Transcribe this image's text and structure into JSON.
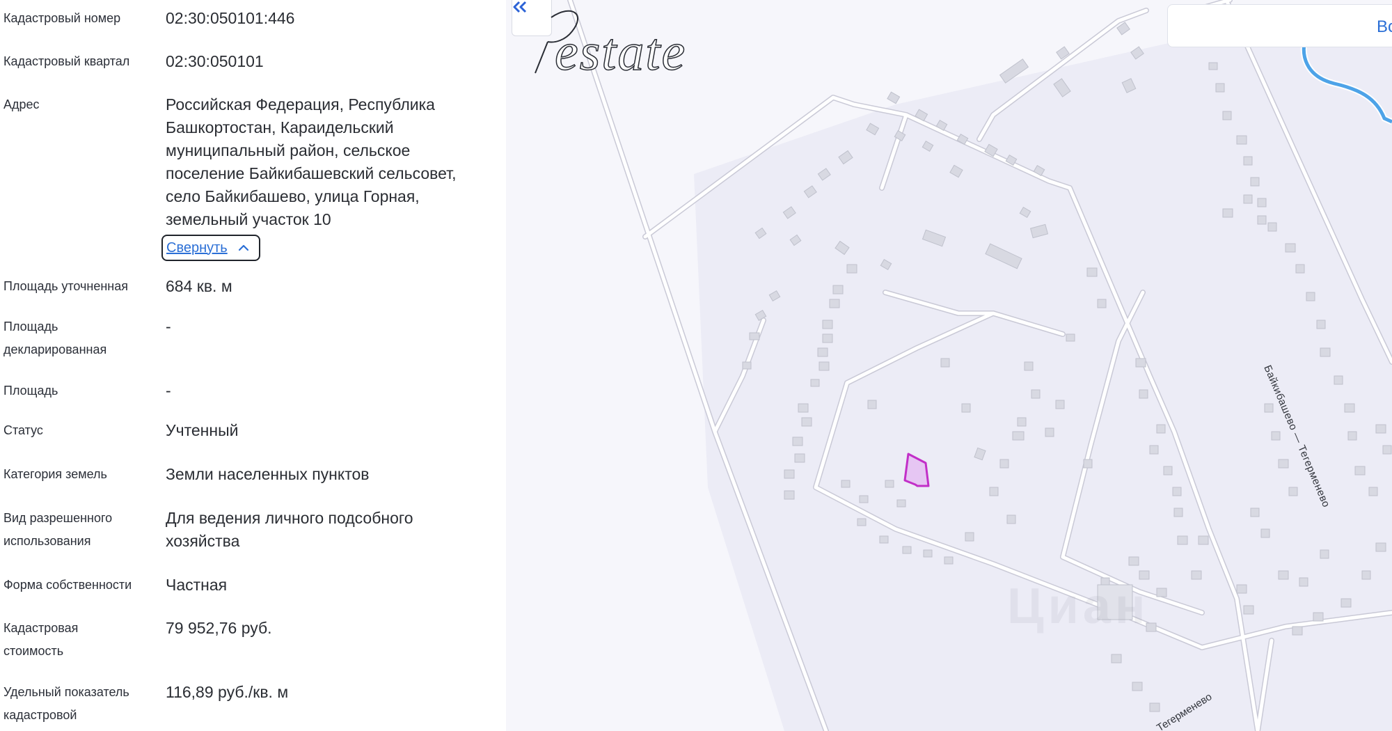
{
  "info": {
    "rows": [
      {
        "label": "Кадастровый номер",
        "value": "02:30:050101:446"
      },
      {
        "label": "Кадастровый квартал",
        "value": "02:30:050101"
      },
      {
        "label": "Адрес",
        "value_lines": [
          "Российская Федерация, Республика",
          "Башкортостан, Караидельский",
          "муниципальный район, сельское",
          "поселение Байкибашевский сельсовет,",
          "село Байкибашево, улица Горная,",
          "земельный участок 10"
        ]
      },
      {
        "label": "Площадь уточненная",
        "value": "684 кв. м"
      },
      {
        "label_lines": [
          "Площадь",
          "декларированная"
        ],
        "value": "-"
      },
      {
        "label": "Площадь",
        "value": "-"
      },
      {
        "label": "Статус",
        "value": "Учтенный"
      },
      {
        "label": "Категория земель",
        "value": "Земли населенных пунктов"
      },
      {
        "label_lines": [
          "Вид разрешенного",
          "использования"
        ],
        "value_lines": [
          "Для ведения личного подсобного",
          "хозяйства"
        ]
      },
      {
        "label": "Форма собственности",
        "value": "Частная"
      },
      {
        "label_lines": [
          "Кадастровая",
          "стоимость"
        ],
        "value": "79 952,76 руб."
      },
      {
        "label_lines": [
          "Удельный показатель",
          "кадастровой"
        ],
        "value": "116,89 руб./кв. м"
      }
    ],
    "collapse_label": "Свернуть"
  },
  "map": {
    "top_button_text": "Вс",
    "road_label": "Байкибашево — Тегерменево",
    "road_label_2": "Тегерменево",
    "watermark": "Циан",
    "logo_text": "Restate",
    "colors": {
      "background": "#f6f6fb",
      "road": "#ffffff",
      "building": "#d8d9e2",
      "parcel": "#cc33cc",
      "river": "#4da3e8"
    }
  }
}
